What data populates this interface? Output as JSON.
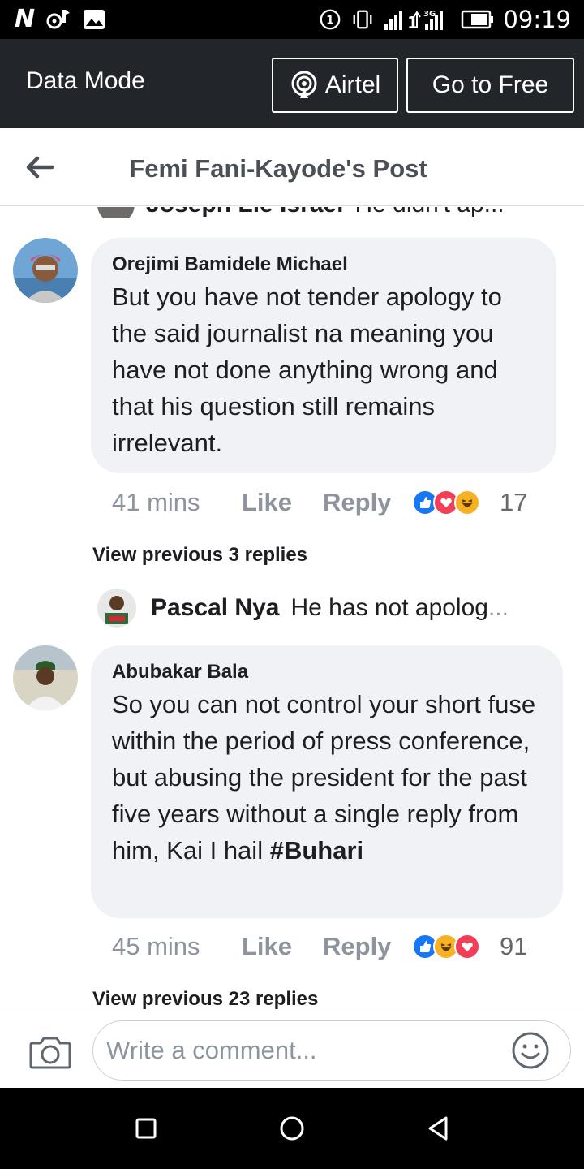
{
  "status_bar": {
    "logo": "N",
    "time": "09:19",
    "network_label": "3G",
    "icons": [
      "n-logo",
      "music-notification-icon",
      "image-icon",
      "hotspot-icon",
      "vibrate-icon",
      "signal-icon",
      "data-arrows-icon",
      "battery-icon"
    ]
  },
  "data_mode": {
    "label": "Data Mode",
    "carrier_button": "Airtel",
    "free_button": "Go to Free",
    "carrier_icon": "broadcast-icon"
  },
  "header": {
    "title": "Femi Fani-Kayode's Post",
    "back_icon": "back-arrow-icon"
  },
  "cut_off_reply": {
    "name": "Joseph Lie Israel",
    "text": "He didn't ap...",
    "avatar_color": "#6d6a6a"
  },
  "comments": [
    {
      "author": "Orejimi Bamidele Michael",
      "text": "But you have not tender apology to the said journalist na meaning you have not done anything wrong and that his question still remains irrelevant.",
      "time": "41 mins",
      "like_label": "Like",
      "reply_label": "Reply",
      "reactions": [
        "like",
        "love",
        "haha"
      ],
      "reaction_count": "17",
      "view_previous": "View previous 3 replies",
      "preview_reply": {
        "name": "Pascal Nya",
        "text": "He has not apolog",
        "ellipsis": "..."
      }
    },
    {
      "author": "Abubakar Bala",
      "text": "So you can not control your short fuse within the period of press conference, but abusing the president for the past five years without a single reply from him, Kai I hail ",
      "hashtag": "#Buhari",
      "time": "45 mins",
      "like_label": "Like",
      "reply_label": "Reply",
      "reactions": [
        "like",
        "haha",
        "love"
      ],
      "reaction_count": "91",
      "view_previous": "View previous 23 replies"
    }
  ],
  "composer": {
    "placeholder": "Write a comment...",
    "camera_icon": "camera-icon",
    "emoji_icon": "emoji-icon"
  },
  "nav_bar": {
    "icons": [
      "recents-square-icon",
      "home-circle-icon",
      "back-triangle-icon"
    ]
  },
  "colors": {
    "data_bar": "#22252a",
    "bubble": "#f0f2f5",
    "meta_text": "#8d949e",
    "like_blue": "#1877f2",
    "love_red": "#f33e58",
    "haha_yellow": "#f7b125"
  }
}
